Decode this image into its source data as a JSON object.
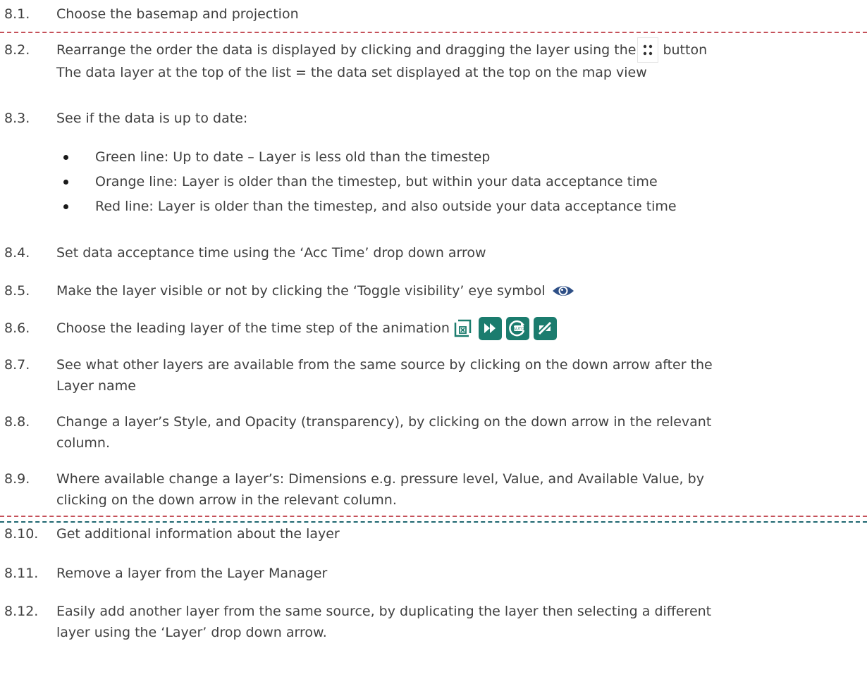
{
  "colors": {
    "red_divider": "#c5515a",
    "teal_divider": "#1e6670",
    "text": "#404040",
    "icon_teal": "#1b7c6e"
  },
  "icons": [
    "drag-handle-icon",
    "eye-icon",
    "stop-icon",
    "fast-forward-icon",
    "auto-icon",
    "no-follow-icon"
  ],
  "items": [
    {
      "num": "8.1.",
      "text": "Choose the basemap and projection"
    },
    {
      "num": "8.2.",
      "text_a": "Rearrange the order the data is displayed by clicking and dragging the layer using the",
      "text_b": "button",
      "cont": "The data layer at the top of the list = the data set displayed at the top on the map view"
    },
    {
      "num": "8.3.",
      "text": "See if the data is up to date:",
      "bullets": [
        "Green line: Up to date – Layer is less old than the timestep",
        "Orange line: Layer is older than the timestep, but within your data acceptance time",
        "Red line: Layer is older than the timestep, and also outside your data acceptance time"
      ]
    },
    {
      "num": "8.4.",
      "text": "Set data acceptance time using the ‘Acc Time’ drop down arrow"
    },
    {
      "num": "8.5.",
      "text": "Make the layer visible or not by clicking the ‘Toggle visibility’ eye symbol"
    },
    {
      "num": "8.6.",
      "text": " Choose the leading layer of the time step of the animation"
    },
    {
      "num": "8.7.",
      "text": "See what other layers are available from the same source by clicking on the down arrow after the",
      "cont": "Layer name"
    },
    {
      "num": "8.8.",
      "text": "Change a layer’s Style, and Opacity (transparency), by clicking on the down arrow in the relevant",
      "cont": "column."
    },
    {
      "num": "8.9.",
      "text": "Where available change a layer’s: Dimensions e.g. pressure level, Value, and Available Value, by",
      "cont": "clicking on the down arrow in the relevant column."
    },
    {
      "num": "8.10.",
      "text": "Get additional information about the layer"
    },
    {
      "num": "8.11.",
      "text": "Remove a layer from the Layer Manager"
    },
    {
      "num": "8.12.",
      "text": "Easily add another layer from the same source, by duplicating the layer then selecting a different",
      "cont": "layer using the ‘Layer’ drop down arrow."
    }
  ]
}
